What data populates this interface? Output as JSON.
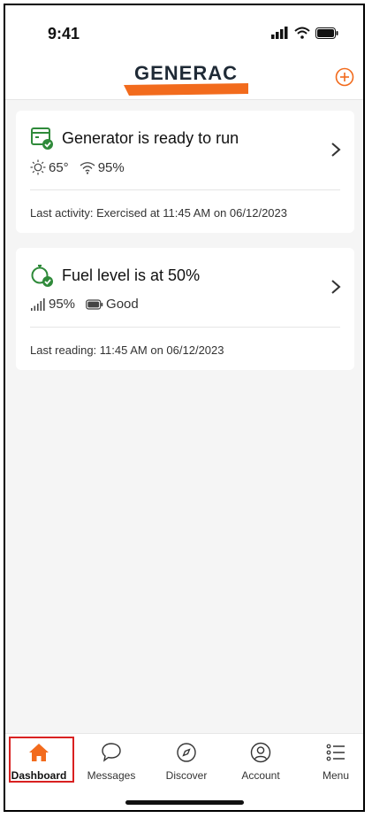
{
  "status_bar": {
    "time": "9:41"
  },
  "header": {
    "logo_text": "GENERAC"
  },
  "cards": [
    {
      "title": "Generator is ready to run",
      "temperature": "65°",
      "wifi": "95%",
      "last_activity": "Last activity: Exercised at 11:45 AM on 06/12/2023",
      "status_color": "#2f8a3a"
    },
    {
      "title": "Fuel level is at 50%",
      "signal": "95%",
      "battery": "Good",
      "last_reading": "Last reading: 11:45 AM on 06/12/2023",
      "status_color": "#2f8a3a"
    }
  ],
  "tabs": [
    {
      "label": "Dashboard",
      "icon": "home-icon",
      "active": true
    },
    {
      "label": "Messages",
      "icon": "chat-bubble-icon",
      "active": false
    },
    {
      "label": "Discover",
      "icon": "compass-icon",
      "active": false
    },
    {
      "label": "Account",
      "icon": "user-circle-icon",
      "active": false
    },
    {
      "label": "Menu",
      "icon": "list-icon",
      "active": false
    }
  ],
  "colors": {
    "accent": "#f26b1d",
    "logo_dark": "#1f2a36",
    "highlight": "#d92121"
  }
}
